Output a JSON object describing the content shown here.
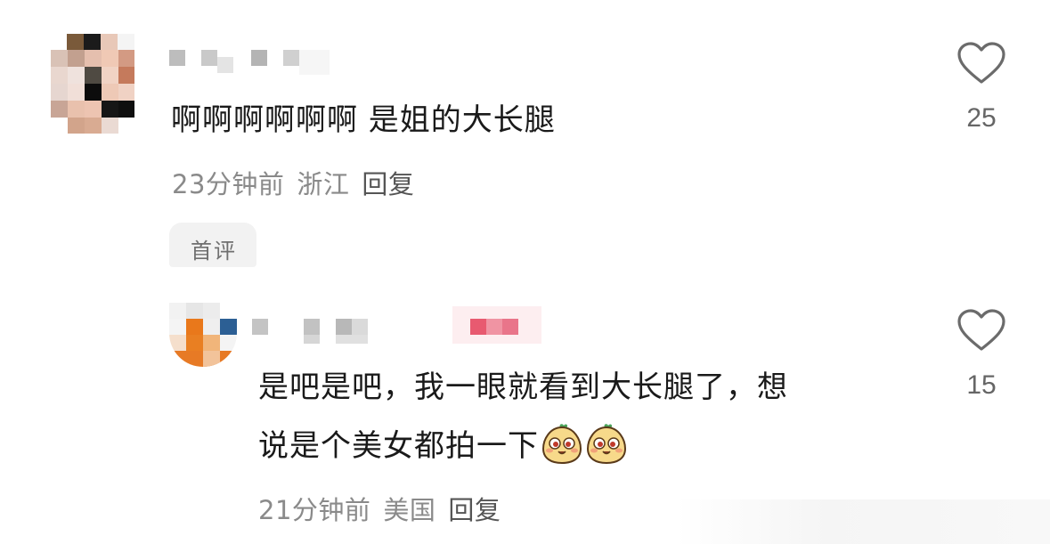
{
  "comments": [
    {
      "text": "啊啊啊啊啊啊 是姐的大长腿",
      "time": "23分钟前",
      "location": "浙江",
      "reply_label": "回复",
      "likes": "25",
      "badge": "首评"
    },
    {
      "text_line1": "是吧是吧，我一眼就看到大长腿了，想",
      "text_line2": "说是个美女都拍一下",
      "emojis": [
        "cute-face-emoji",
        "cute-face-emoji"
      ],
      "time": "21分钟前",
      "location": "美国",
      "reply_label": "回复",
      "likes": "15"
    }
  ]
}
